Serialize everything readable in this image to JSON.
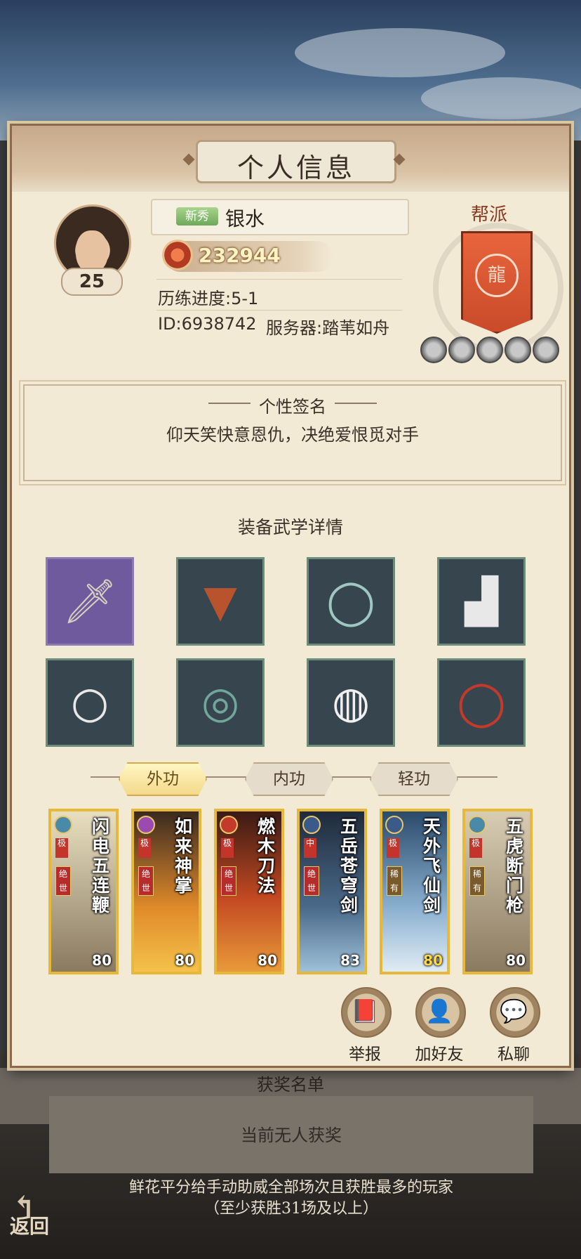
{
  "panel": {
    "title": "个人信息"
  },
  "player": {
    "level": "25",
    "rookie_tag": "新秀",
    "name": "银水",
    "power": "232944",
    "progress": "历练进度:5-1",
    "id_line": "ID:6938742",
    "server": "服务器:踏苇如舟"
  },
  "guild": {
    "label": "帮派",
    "emblem_icon": "dragon-emblem-icon",
    "color": "#d9553a"
  },
  "signature": {
    "title": "个性签名",
    "text": "仰天笑快意恩仇，决绝爱恨觅对手"
  },
  "equipment": {
    "title": "装备武学详情",
    "slots": [
      {
        "name": "dagger-icon",
        "rarity": "purple"
      },
      {
        "name": "armor-icon",
        "rarity": "green"
      },
      {
        "name": "belt-icon",
        "rarity": "green"
      },
      {
        "name": "boots-icon",
        "rarity": "green"
      },
      {
        "name": "necklace-icon",
        "rarity": "green"
      },
      {
        "name": "jade-pendant-icon",
        "rarity": "green"
      },
      {
        "name": "ring-icon",
        "rarity": "green"
      },
      {
        "name": "bracelet-icon",
        "rarity": "green"
      }
    ]
  },
  "tabs": [
    {
      "label": "外功",
      "active": true
    },
    {
      "label": "内功",
      "active": false
    },
    {
      "label": "轻功",
      "active": false
    }
  ],
  "skills": [
    {
      "name": "闪电五连鞭",
      "level": "80",
      "grade": "极",
      "tag": "绝世",
      "color": "#d8cfa8"
    },
    {
      "name": "如来神掌",
      "level": "80",
      "grade": "极",
      "tag": "绝世",
      "color": "#c9702c"
    },
    {
      "name": "燃木刀法",
      "level": "80",
      "grade": "极",
      "tag": "绝世",
      "color": "#b8412a"
    },
    {
      "name": "五岳苍穹剑",
      "level": "83",
      "grade": "中",
      "tag": "绝世",
      "color": "#3f5b7a"
    },
    {
      "name": "天外飞仙剑",
      "level": "80",
      "grade": "极",
      "tag": "稀有",
      "color": "#6e8fb0"
    },
    {
      "name": "五虎断门枪",
      "level": "80",
      "grade": "极",
      "tag": "稀有",
      "color": "#a69478"
    }
  ],
  "actions": [
    {
      "label": "举报",
      "icon": "blacklist-book-icon"
    },
    {
      "label": "加好友",
      "icon": "add-friend-icon"
    },
    {
      "label": "私聊",
      "icon": "chat-bubble-icon"
    }
  ],
  "background": {
    "awards_title": "获奖名单",
    "awards_empty": "当前无人获奖",
    "rule_text": "鲜花平分给手动助威全部场次且获胜最多的玩家（至少获胜31场及以上）",
    "back_label": "返回"
  }
}
